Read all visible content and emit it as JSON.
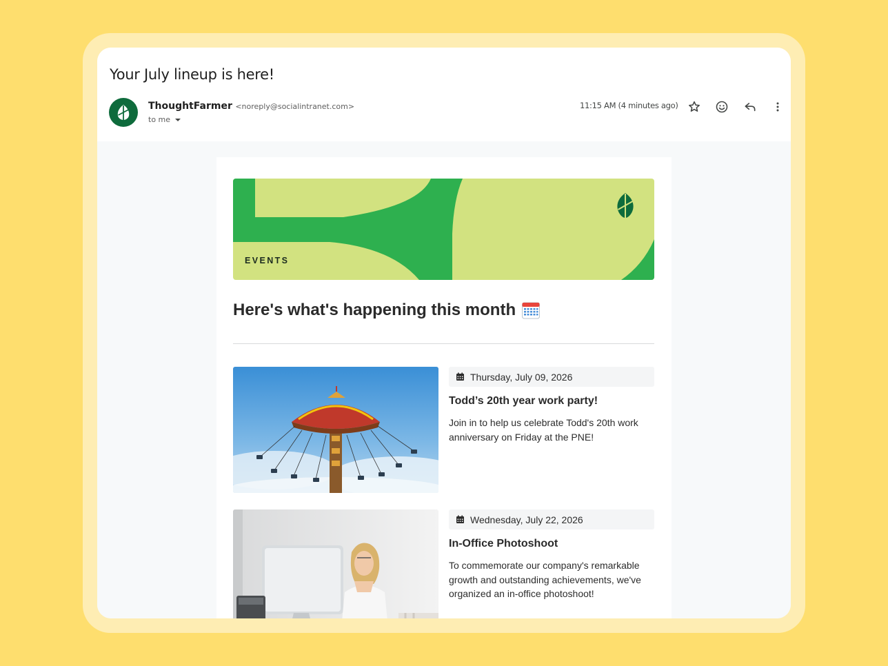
{
  "email": {
    "subject": "Your July lineup is here!",
    "sender_name": "ThoughtFarmer",
    "sender_email": "<noreply@socialintranet.com>",
    "recipient": "to me",
    "timestamp": "11:15 AM (4 minutes ago)"
  },
  "actions": {
    "star": "star-icon",
    "emoji": "emoji-icon",
    "reply": "reply-icon",
    "more": "more-vert-icon"
  },
  "banner": {
    "label": "EVENTS",
    "colors": {
      "light": "#D2E280",
      "green": "#2EB04F",
      "dark": "#0E6B3C"
    }
  },
  "content": {
    "heading": "Here's what's happening this month"
  },
  "events": [
    {
      "date": "Thursday, July 09, 2026",
      "title": "Todd’s 20th year work party!",
      "description": "Join in to help us celebrate Todd's 20th work anniversary on Friday at the PNE!"
    },
    {
      "date": "Wednesday, July 22, 2026",
      "title": "In-Office Photoshoot",
      "description": "To commemorate our company's remarkable growth and outstanding achievements, we've organized an in-office photoshoot!"
    }
  ]
}
